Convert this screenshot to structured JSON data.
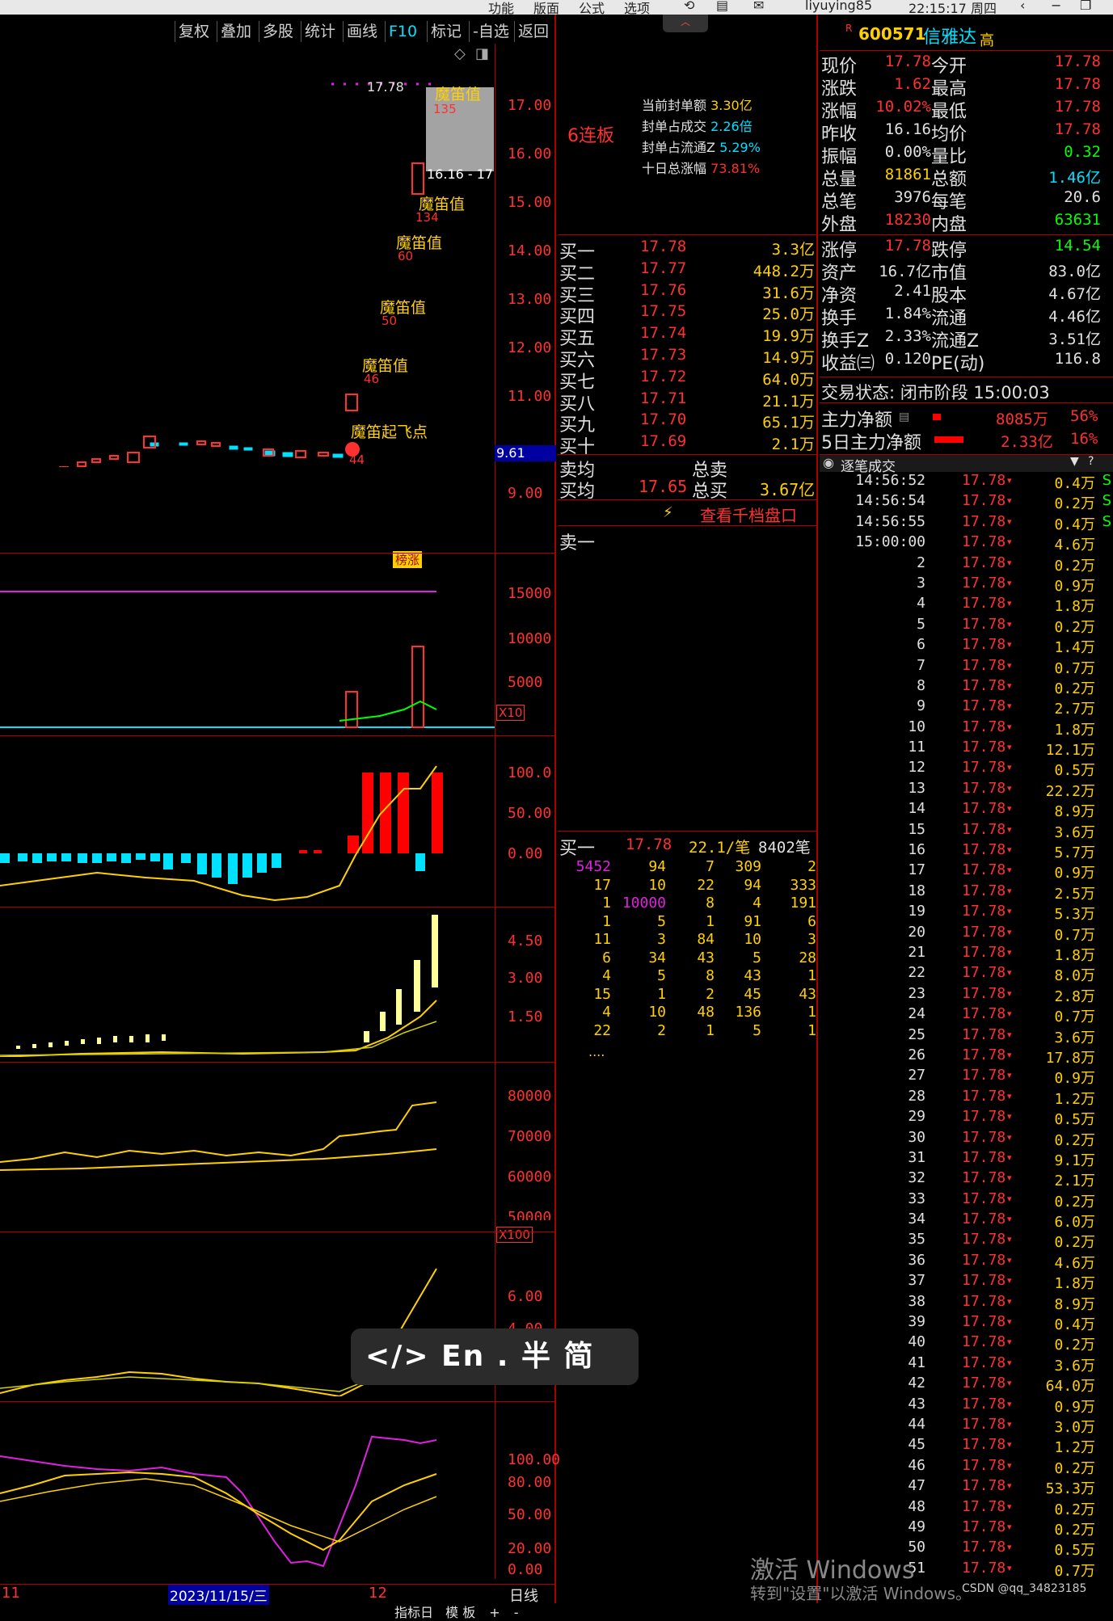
{
  "topbar": {
    "items": [
      "功能",
      "版面",
      "公式",
      "选项"
    ],
    "user": "liyuying85",
    "time": "22:15:17 周四"
  },
  "toolbar": [
    "复权",
    "叠加",
    "多股",
    "统计",
    "画线",
    "F10",
    "标记",
    "-自选",
    "返回"
  ],
  "price_axis": [
    "17.00",
    "16.00",
    "15.00",
    "14.00",
    "13.00",
    "12.00",
    "11.00",
    "9.00"
  ],
  "current_price_tag": "9.61",
  "annotations": {
    "top_price": "17.78",
    "range": "16.16 - 17",
    "mdz": "魔笛值",
    "n135": "135",
    "n134": "134",
    "n60": "60",
    "n50": "50",
    "n46": "46",
    "takeoff": "魔笛起飞点",
    "n44": "44",
    "bangzhang": "榜涨"
  },
  "vol_axis": [
    "15000",
    "10000",
    "5000"
  ],
  "vol_unit": "X10",
  "macd_axis": [
    "100.0",
    "50.00",
    "0.00"
  ],
  "ind3_axis": [
    "4.50",
    "3.00",
    "1.50"
  ],
  "ind4_axis": [
    "80000",
    "70000",
    "60000",
    "50000"
  ],
  "ind4_unit": "X100",
  "ind5_axis": [
    "6.00",
    "4.00"
  ],
  "ind6_axis": [
    "100.00",
    "80.00",
    "50.00",
    "20.00",
    "0.00"
  ],
  "date_bar": {
    "left": "11",
    "date": "2023/11/15/三",
    "mid": "12",
    "right": "日线"
  },
  "bottom_tabs": [
    "指标日",
    "模 板",
    "+",
    "-"
  ],
  "mid": {
    "streak": "6连板",
    "seal": [
      {
        "k": "当前封单额",
        "v": "3.30亿"
      },
      {
        "k": "封单占成交",
        "v": "2.26倍"
      },
      {
        "k": "封单占流通Z",
        "v": "5.29%"
      },
      {
        "k": "十日总涨幅",
        "v": "73.81%"
      }
    ],
    "bids": [
      [
        "买一",
        "17.78",
        "3.3亿"
      ],
      [
        "买二",
        "17.77",
        "448.2万"
      ],
      [
        "买三",
        "17.76",
        "31.6万"
      ],
      [
        "买四",
        "17.75",
        "25.0万"
      ],
      [
        "买五",
        "17.74",
        "19.9万"
      ],
      [
        "买六",
        "17.73",
        "14.9万"
      ],
      [
        "买七",
        "17.72",
        "64.0万"
      ],
      [
        "买八",
        "17.71",
        "21.1万"
      ],
      [
        "买九",
        "17.70",
        "65.1万"
      ],
      [
        "买十",
        "17.69",
        "2.1万"
      ]
    ],
    "avg_sell": "卖均",
    "total_sell": "总卖",
    "avg_buy": "买均",
    "avg_buy_p": "17.65",
    "total_buy": "总买",
    "total_buy_v": "3.67亿",
    "view_levels": "查看千档盘口",
    "sell1": "卖一",
    "queue_head": {
      "label": "买一",
      "price": "17.78",
      "per": "22.1/笔",
      "count": "8402笔"
    },
    "queue": [
      [
        "5452",
        "94",
        "7",
        "309",
        "2"
      ],
      [
        "17",
        "10",
        "22",
        "94",
        "333"
      ],
      [
        "1",
        "10000",
        "8",
        "4",
        "191"
      ],
      [
        "1",
        "5",
        "1",
        "91",
        "6"
      ],
      [
        "11",
        "3",
        "84",
        "10",
        "3"
      ],
      [
        "6",
        "34",
        "43",
        "5",
        "28"
      ],
      [
        "4",
        "5",
        "8",
        "43",
        "1"
      ],
      [
        "15",
        "1",
        "2",
        "45",
        "43"
      ],
      [
        "4",
        "10",
        "48",
        "136",
        "1"
      ],
      [
        "22",
        "2",
        "1",
        "5",
        "1"
      ]
    ],
    "queue_more": "...."
  },
  "right": {
    "code": "600571",
    "name": "信雅达",
    "name_suffix": "高",
    "r": "R",
    "stats": [
      [
        "现价",
        "17.78",
        "今开",
        "17.78"
      ],
      [
        "涨跌",
        "1.62",
        "最高",
        "17.78"
      ],
      [
        "涨幅",
        "10.02%",
        "最低",
        "17.78"
      ],
      [
        "昨收",
        "16.16",
        "均价",
        "17.78"
      ],
      [
        "振幅",
        "0.00%",
        "量比",
        "0.32"
      ],
      [
        "总量",
        "81861",
        "总额",
        "1.46亿"
      ],
      [
        "总笔",
        "3976",
        "每笔",
        "20.6"
      ],
      [
        "外盘",
        "18230",
        "内盘",
        "63631"
      ]
    ],
    "stats2": [
      [
        "涨停",
        "17.78",
        "跌停",
        "14.54"
      ],
      [
        "资产",
        "16.7亿",
        "市值",
        "83.0亿"
      ],
      [
        "净资",
        "2.41",
        "股本",
        "4.67亿"
      ],
      [
        "换手",
        "1.84%",
        "流通",
        "4.46亿"
      ],
      [
        "换手Z",
        "2.33%",
        "流通Z",
        "3.51亿"
      ],
      [
        "收益㈢",
        "0.120",
        "PE(动)",
        "116.8"
      ]
    ],
    "trade_status": "交易状态: 闭市阶段 15:00:03",
    "main_flow": {
      "label": "主力净额",
      "v": "8085万",
      "p": "56%"
    },
    "flow5": {
      "label": "5日主力净额",
      "v": "2.33亿",
      "p": "16%"
    },
    "ticks_title": "逐笔成交",
    "ticks": [
      [
        "14:56:52",
        "17.78",
        "0.4万",
        "S"
      ],
      [
        "14:56:54",
        "17.78",
        "0.2万",
        "S"
      ],
      [
        "14:56:55",
        "17.78",
        "0.4万",
        "S"
      ],
      [
        "15:00:00",
        "17.78",
        "4.6万",
        ""
      ],
      [
        "2",
        "17.78",
        "0.2万",
        ""
      ],
      [
        "3",
        "17.78",
        "0.9万",
        ""
      ],
      [
        "4",
        "17.78",
        "1.8万",
        ""
      ],
      [
        "5",
        "17.78",
        "0.2万",
        ""
      ],
      [
        "6",
        "17.78",
        "1.4万",
        ""
      ],
      [
        "7",
        "17.78",
        "0.7万",
        ""
      ],
      [
        "8",
        "17.78",
        "0.2万",
        ""
      ],
      [
        "9",
        "17.78",
        "2.7万",
        ""
      ],
      [
        "10",
        "17.78",
        "1.8万",
        ""
      ],
      [
        "11",
        "17.78",
        "12.1万",
        ""
      ],
      [
        "12",
        "17.78",
        "0.5万",
        ""
      ],
      [
        "13",
        "17.78",
        "22.2万",
        ""
      ],
      [
        "14",
        "17.78",
        "8.9万",
        ""
      ],
      [
        "15",
        "17.78",
        "3.6万",
        ""
      ],
      [
        "16",
        "17.78",
        "5.7万",
        ""
      ],
      [
        "17",
        "17.78",
        "0.9万",
        ""
      ],
      [
        "18",
        "17.78",
        "2.5万",
        ""
      ],
      [
        "19",
        "17.78",
        "5.3万",
        ""
      ],
      [
        "20",
        "17.78",
        "0.7万",
        ""
      ],
      [
        "21",
        "17.78",
        "1.8万",
        ""
      ],
      [
        "22",
        "17.78",
        "8.0万",
        ""
      ],
      [
        "23",
        "17.78",
        "2.8万",
        ""
      ],
      [
        "24",
        "17.78",
        "0.7万",
        ""
      ],
      [
        "25",
        "17.78",
        "3.6万",
        ""
      ],
      [
        "26",
        "17.78",
        "17.8万",
        ""
      ],
      [
        "27",
        "17.78",
        "0.9万",
        ""
      ],
      [
        "28",
        "17.78",
        "1.2万",
        ""
      ],
      [
        "29",
        "17.78",
        "0.5万",
        ""
      ],
      [
        "30",
        "17.78",
        "0.2万",
        ""
      ],
      [
        "31",
        "17.78",
        "9.1万",
        ""
      ],
      [
        "32",
        "17.78",
        "2.1万",
        ""
      ],
      [
        "33",
        "17.78",
        "0.2万",
        ""
      ],
      [
        "34",
        "17.78",
        "6.0万",
        ""
      ],
      [
        "35",
        "17.78",
        "0.2万",
        ""
      ],
      [
        "36",
        "17.78",
        "4.6万",
        ""
      ],
      [
        "37",
        "17.78",
        "1.8万",
        ""
      ],
      [
        "38",
        "17.78",
        "8.9万",
        ""
      ],
      [
        "39",
        "17.78",
        "0.4万",
        ""
      ],
      [
        "40",
        "17.78",
        "0.2万",
        ""
      ],
      [
        "41",
        "17.78",
        "3.6万",
        ""
      ],
      [
        "42",
        "17.78",
        "64.0万",
        ""
      ],
      [
        "43",
        "17.78",
        "0.9万",
        ""
      ],
      [
        "44",
        "17.78",
        "3.0万",
        ""
      ],
      [
        "45",
        "17.78",
        "1.2万",
        ""
      ],
      [
        "46",
        "17.78",
        "0.2万",
        ""
      ],
      [
        "47",
        "17.78",
        "53.3万",
        ""
      ],
      [
        "48",
        "17.78",
        "0.2万",
        ""
      ],
      [
        "49",
        "17.78",
        "0.2万",
        ""
      ],
      [
        "50",
        "17.78",
        "0.5万",
        ""
      ],
      [
        "51",
        "17.78",
        "0.7万",
        ""
      ]
    ]
  },
  "ime": "</> En . 半 简",
  "watermark": {
    "l1": "激活 Windows",
    "l2": "转到\"设置\"以激活 Windows。",
    "csdn": "CSDN @qq_34823185"
  },
  "colors": {
    "up": "#ff3030",
    "down": "#00e0ff",
    "yellow": "#ffd000",
    "bg": "#000000"
  }
}
